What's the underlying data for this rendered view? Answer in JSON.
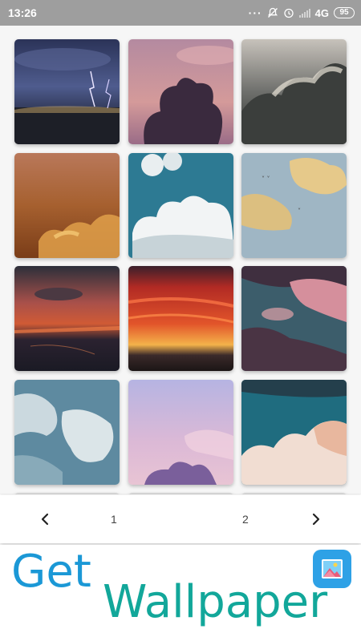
{
  "status_bar": {
    "time": "13:26",
    "network": "4G",
    "battery": "95"
  },
  "gallery": {
    "wallpapers": [
      {
        "name": "lightning-storm"
      },
      {
        "name": "purple-cloud-silhouette"
      },
      {
        "name": "grey-storm-clouds"
      },
      {
        "name": "orange-sunset-clouds"
      },
      {
        "name": "blue-sky-white-clouds"
      },
      {
        "name": "yellow-clouds-birds"
      },
      {
        "name": "red-sunset-city"
      },
      {
        "name": "fiery-red-sunset"
      },
      {
        "name": "pink-teal-clouds"
      },
      {
        "name": "pale-blue-clouds"
      },
      {
        "name": "lavender-pink-sky"
      },
      {
        "name": "teal-sky-peach-clouds"
      }
    ]
  },
  "pagination": {
    "prev_icon": "chevron-left-icon",
    "next_icon": "chevron-right-icon",
    "pages": [
      "1",
      "2"
    ]
  },
  "branding": {
    "word1": "Get",
    "word2": "Wallpaper",
    "color1": "#1b98d6",
    "color2": "#12a79a",
    "app_icon": "image-icon"
  }
}
